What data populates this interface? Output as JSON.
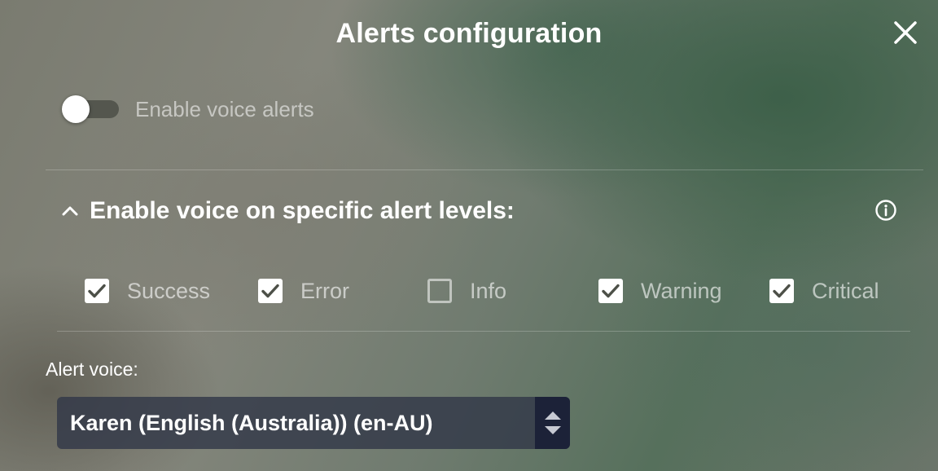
{
  "dialog": {
    "title": "Alerts configuration",
    "close_icon": "close-icon"
  },
  "voice_toggle": {
    "label": "Enable voice alerts",
    "enabled": false
  },
  "levels": {
    "title": "Enable voice on specific alert levels:",
    "expanded": true,
    "items": [
      {
        "label": "Success",
        "checked": true
      },
      {
        "label": "Error",
        "checked": true
      },
      {
        "label": "Info",
        "checked": false
      },
      {
        "label": "Warning",
        "checked": true
      },
      {
        "label": "Critical",
        "checked": true
      }
    ]
  },
  "voice_select": {
    "label": "Alert voice:",
    "selected": "Karen (English (Australia)) (en-AU)"
  },
  "colors": {
    "text": "#ffffff",
    "select_bg": "#323848",
    "select_arrow_bg": "#1c2238"
  }
}
